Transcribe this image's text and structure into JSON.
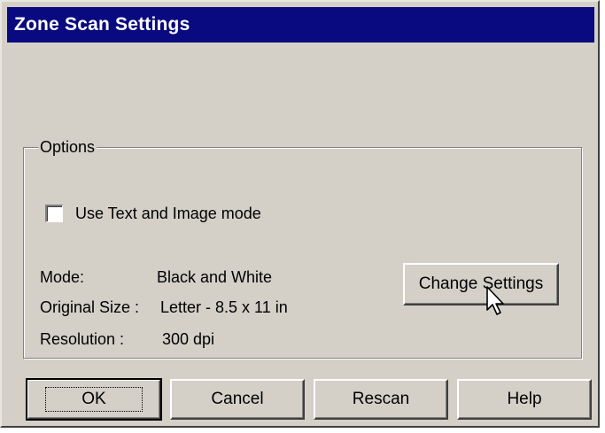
{
  "window": {
    "title": "Zone Scan Settings"
  },
  "options": {
    "legend": "Options",
    "checkbox_label": "Use Text and Image mode",
    "checkbox_checked": false,
    "mode_label": "Mode:",
    "mode_value": "Black and White",
    "size_label": "Original Size :",
    "size_value": "Letter - 8.5 x 11 in",
    "resolution_label": "Resolution :",
    "resolution_value": "300 dpi",
    "change_settings_label": "Change Settings"
  },
  "buttons": {
    "ok": "OK",
    "cancel": "Cancel",
    "rescan": "Rescan",
    "help": "Help"
  },
  "colors": {
    "titlebar": "#0a0a80",
    "face": "#d4d0c8"
  }
}
